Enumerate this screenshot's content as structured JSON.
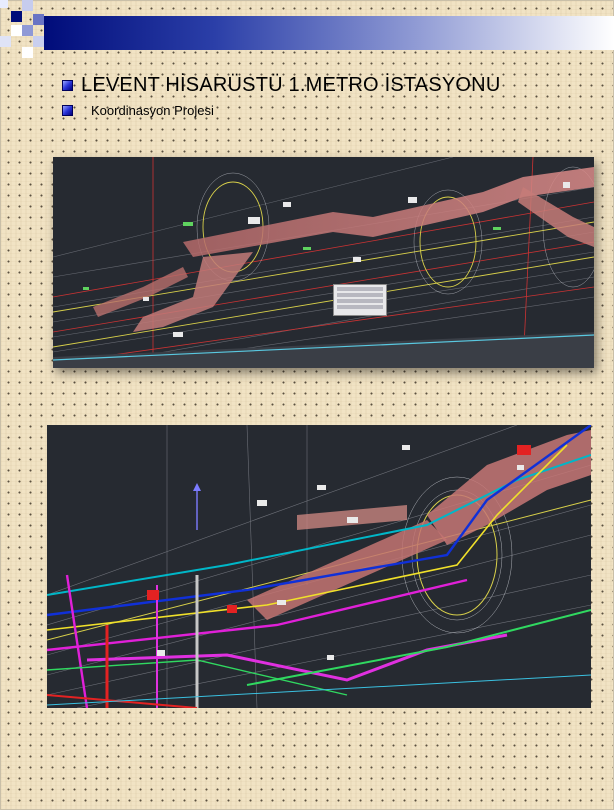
{
  "slide": {
    "title": "LEVENT HİSARÜSTÜ 1.METRO İSTASYONU",
    "subtitle": "Koordinasyon Projesi"
  },
  "images": [
    {
      "name": "cad-model-view-1",
      "description_icon": "tunnel-cad-render"
    },
    {
      "name": "cad-model-view-2",
      "description_icon": "tunnel-cad-render"
    }
  ],
  "colors": {
    "header_dark": "#000c7a",
    "bullet_blue": "#2a34d8",
    "background": "#f1e3c4",
    "cad_background": "#262a31"
  }
}
